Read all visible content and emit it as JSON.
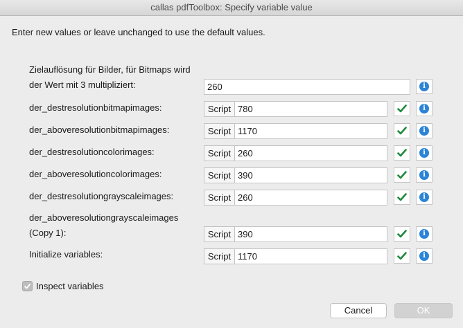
{
  "window": {
    "title": "callas pdfToolbox: Specify variable value"
  },
  "instruction": "Enter new values or leave unchanged to use the default values.",
  "first_row": {
    "label_line1": "Zielauflösung für Bilder, für Bitmaps wird",
    "label_line2": "der Wert mit 3 multipliziert:",
    "value": "260"
  },
  "rows": [
    {
      "label": "der_destresolutionbitmapimages:",
      "script_label": "Script",
      "value": "780"
    },
    {
      "label": "der_aboveresolutionbitmapimages:",
      "script_label": "Script",
      "value": "1170"
    },
    {
      "label": "der_destresolutioncolorimages:",
      "script_label": "Script",
      "value": "260"
    },
    {
      "label": "der_aboveresolutioncolorimages:",
      "script_label": "Script",
      "value": "390"
    },
    {
      "label": "der_destresolutiongrayscaleimages:",
      "script_label": "Script",
      "value": "260"
    },
    {
      "label_line1": "der_aboveresolutiongrayscaleimages",
      "label_line2": "(Copy 1):",
      "script_label": "Script",
      "value": "390"
    },
    {
      "label": "Initialize variables:",
      "script_label": "Script",
      "value": "1170"
    }
  ],
  "inspect": {
    "label": "Inspect variables",
    "checked": true
  },
  "buttons": {
    "cancel": "Cancel",
    "ok": "OK"
  },
  "colors": {
    "accent": "#2b84d6",
    "check": "#1e8a3c"
  },
  "icons": {
    "check": "checkmark-icon",
    "info": "info-icon"
  }
}
